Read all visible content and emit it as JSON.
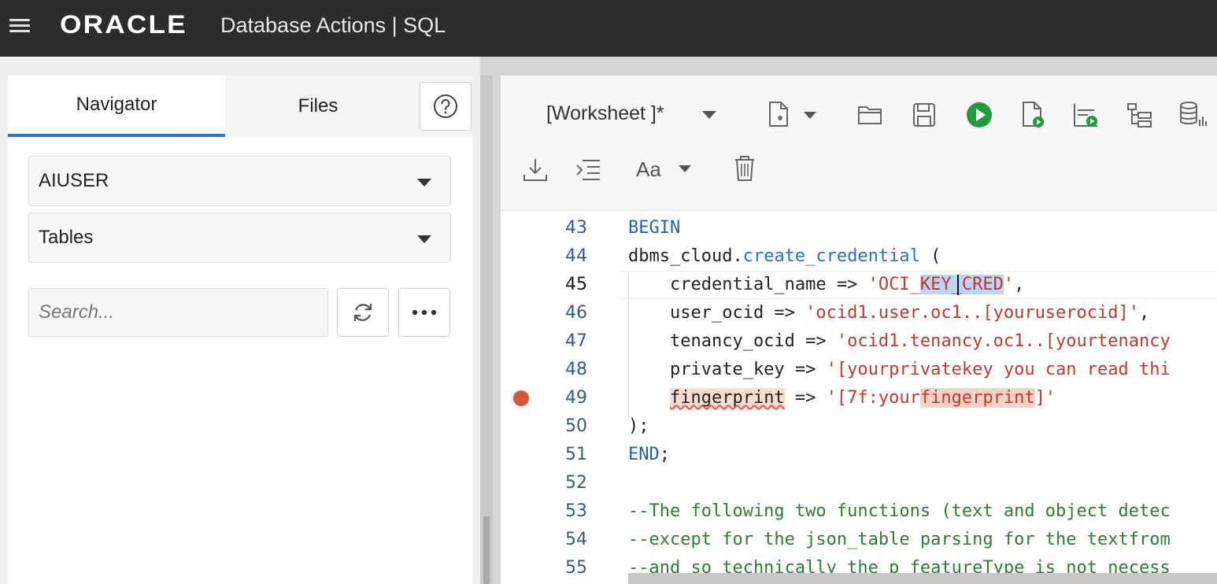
{
  "header": {
    "brand": "ORACLE",
    "product": "Database Actions |  SQL"
  },
  "navigator": {
    "tabs": [
      {
        "label": "Navigator"
      },
      {
        "label": "Files"
      }
    ],
    "schema_select": "AIUSER",
    "object_type_select": "Tables",
    "search_placeholder": "Search..."
  },
  "worksheet": {
    "title": "[Worksheet ]*",
    "font_label": "Aa"
  },
  "editor": {
    "lines": [
      {
        "n": "43"
      },
      {
        "n": "44"
      },
      {
        "n": "45"
      },
      {
        "n": "46"
      },
      {
        "n": "47"
      },
      {
        "n": "48"
      },
      {
        "n": "49"
      },
      {
        "n": "50"
      },
      {
        "n": "51"
      },
      {
        "n": "52"
      },
      {
        "n": "53"
      },
      {
        "n": "54"
      },
      {
        "n": "55"
      }
    ],
    "code": {
      "l43": "BEGIN",
      "l44_obj": "dbms_cloud",
      "l44_dot": ".",
      "l44_fn": "create_credential",
      "l44_paren": " (",
      "l45_name": "    credential_name => ",
      "l45_q1": "'OCI_",
      "l45_sel": "KEY_CRED",
      "l45_q2": "'",
      "l45_end": ",",
      "l46_name": "    user_ocid => ",
      "l46_val": "'ocid1.user.oc1..[youruserocid]'",
      "l46_end": ",",
      "l47_name": "    tenancy_ocid => ",
      "l47_val": "'ocid1.tenancy.oc1..[yourtenancy",
      "l48_name": "    private_key => ",
      "l48_val": "'[yourprivatekey you can read thi",
      "l49_indent": "    ",
      "l49_name": "fingerprint",
      "l49_arrow": " => ",
      "l49_v1": "'[7f:your",
      "l49_v2": "fingerprint",
      "l49_v3": "]'",
      "l50": ");",
      "l51": "END",
      "l51_end": ";",
      "l53": "--The following two functions (text and object detec",
      "l54": "--except for the json_table parsing for the textfrom",
      "l55": "--and so technically the p_featureType is not necess"
    }
  },
  "colors": {
    "header_bg": "#2c2c2c",
    "tab_accent": "#2a73c8",
    "run_green": "#1e9e3a",
    "keyword": "#1f5fbf",
    "string": "#c0392b",
    "comment": "#2f7d32",
    "breakpoint": "#d9533d"
  },
  "icons": {
    "menu": "hamburger-icon",
    "help": "help-circle-icon",
    "refresh": "refresh-icon",
    "more": "more-horizontal-icon",
    "new": "new-worksheet-icon",
    "open": "folder-open-icon",
    "save": "save-icon",
    "run": "run-play-icon",
    "run_script": "run-script-icon",
    "autotrace": "autotrace-icon",
    "explain": "explain-plan-icon",
    "db_stats": "database-stats-icon",
    "download": "download-icon",
    "format": "format-indent-icon",
    "clear": "trash-icon"
  }
}
